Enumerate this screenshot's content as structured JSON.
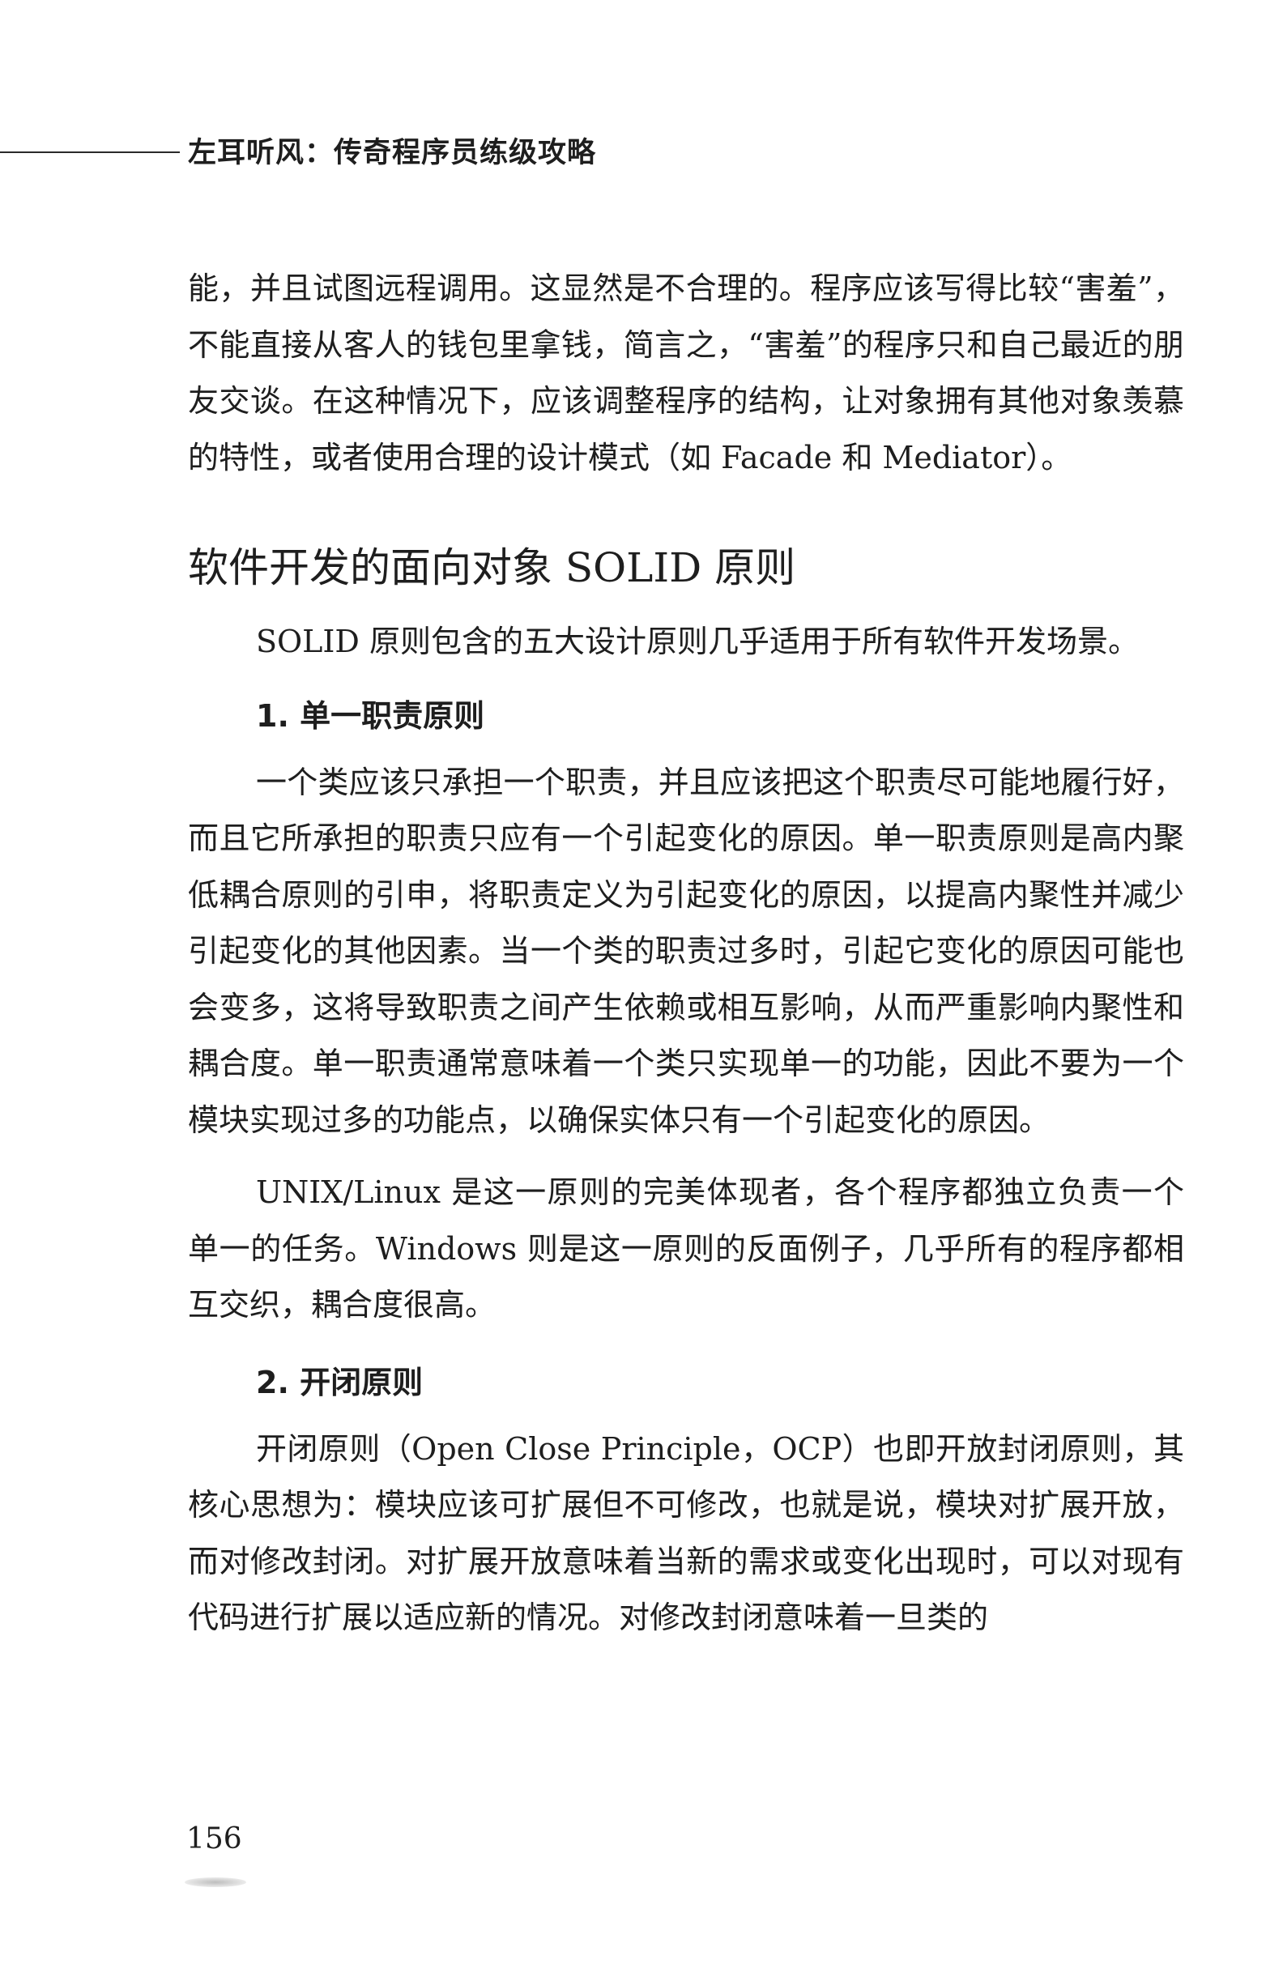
{
  "header": {
    "running_title": "左耳听风：传奇程序员练级攻略"
  },
  "intro_paragraph": "能，并且试图远程调用。这显然是不合理的。程序应该写得比较“害羞”，不能直接从客人的钱包里拿钱，简言之，“害羞”的程序只和自己最近的朋友交谈。在这种情况下，应该调整程序的结构，让对象拥有其他对象羡慕的特性，或者使用合理的设计模式（如 Facade 和 Mediator）。",
  "section": {
    "title": "软件开发的面向对象 SOLID 原则",
    "intro": "SOLID 原则包含的五大设计原则几乎适用于所有软件开发场景。"
  },
  "principles": [
    {
      "heading": "1. 单一职责原则",
      "paragraphs": [
        "一个类应该只承担一个职责，并且应该把这个职责尽可能地履行好，而且它所承担的职责只应有一个引起变化的原因。单一职责原则是高内聚低耦合原则的引申，将职责定义为引起变化的原因，以提高内聚性并减少引起变化的其他因素。当一个类的职责过多时，引起它变化的原因可能也会变多，这将导致职责之间产生依赖或相互影响，从而严重影响内聚性和耦合度。单一职责通常意味着一个类只实现单一的功能，因此不要为一个模块实现过多的功能点，以确保实体只有一个引起变化的原因。",
        "UNIX/Linux 是这一原则的完美体现者，各个程序都独立负责一个单一的任务。Windows 则是这一原则的反面例子，几乎所有的程序都相互交织，耦合度很高。"
      ]
    },
    {
      "heading": "2. 开闭原则",
      "paragraphs": [
        "开闭原则（Open Close Principle，OCP）也即开放封闭原则，其核心思想为：模块应该可扩展但不可修改，也就是说，模块对扩展开放，而对修改封闭。对扩展开放意味着当新的需求或变化出现时，可以对现有代码进行扩展以适应新的情况。对修改封闭意味着一旦类的"
      ]
    }
  ],
  "footer": {
    "page_number": "156"
  }
}
